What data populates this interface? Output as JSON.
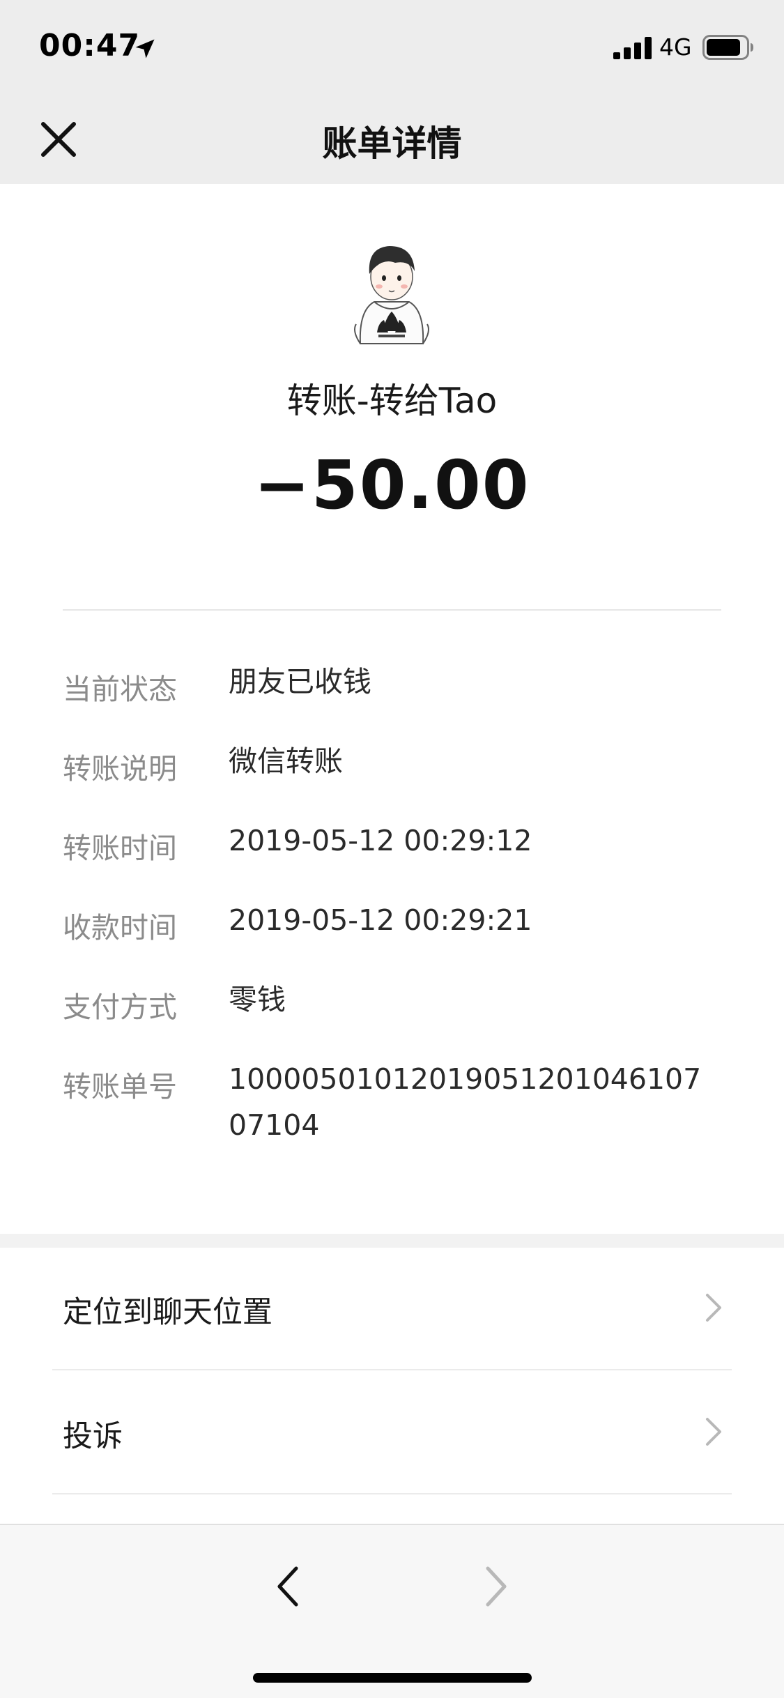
{
  "status_bar": {
    "time": "00:47",
    "network": "4G"
  },
  "nav": {
    "title": "账单详情"
  },
  "transaction": {
    "counterparty": "转账-转给Tao",
    "amount": "−50.00"
  },
  "details": [
    {
      "label": "当前状态",
      "value": "朋友已收钱"
    },
    {
      "label": "转账说明",
      "value": "微信转账"
    },
    {
      "label": "转账时间",
      "value": "2019-05-12 00:29:12"
    },
    {
      "label": "收款时间",
      "value": "2019-05-12 00:29:21"
    },
    {
      "label": "支付方式",
      "value": "零钱"
    },
    {
      "label": "转账单号",
      "value": "1000050101201905120104610707104"
    }
  ],
  "actions": [
    {
      "label": "定位到聊天位置"
    },
    {
      "label": "投诉"
    }
  ],
  "icons": {
    "close": "close-icon",
    "location": "location-arrow-icon",
    "signal": "signal-bars-icon",
    "battery": "battery-icon",
    "chevron": "chevron-right-icon",
    "back": "back-arrow-icon",
    "forward": "forward-arrow-icon"
  },
  "colors": {
    "header_bg": "#ededed",
    "label_gray": "#8b8b8b",
    "chevron_gray": "#b8b8b8"
  }
}
